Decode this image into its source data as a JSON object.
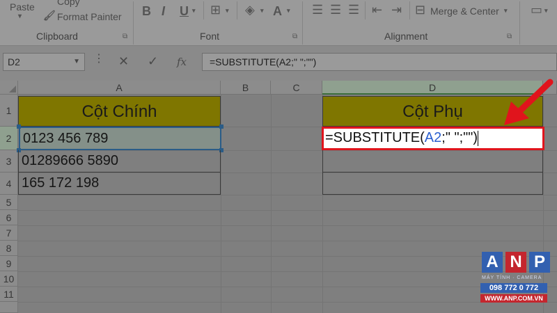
{
  "ribbon": {
    "paste_label": "Paste",
    "copy_label": "Copy",
    "format_painter_label": "Format Painter",
    "clipboard_group": "Clipboard",
    "font_group": "Font",
    "alignment_group": "Alignment",
    "merge_center_label": "Merge & Center",
    "bold_label": "B",
    "italic_label": "I",
    "underline_label": "U",
    "font_color_label": "A"
  },
  "formula_bar": {
    "name_box": "D2",
    "cancel_icon": "✕",
    "enter_icon": "✓",
    "fx_label": "fx",
    "formula": "=SUBSTITUTE(A2;\" \";\"\")"
  },
  "columns": [
    "A",
    "B",
    "C",
    "D"
  ],
  "rows": [
    "1",
    "2",
    "3",
    "4",
    "5",
    "6",
    "7",
    "8",
    "9",
    "10",
    "11"
  ],
  "cells": {
    "A1": "Cột Chính",
    "A2": "0123   456   789",
    "A3": "01289666   5890",
    "A4": "165 172 198",
    "D1": "Cột Phụ",
    "D2_prefix": "=SUBSTITUTE(",
    "D2_ref": "A2",
    "D2_suffix": ";\" \";\"\")"
  },
  "watermark": {
    "letters": [
      "A",
      "N",
      "P"
    ],
    "subtitle": "MÁY TÍNH · CAMERA",
    "phone": "098 772 0 772",
    "website": "WWW.ANP.COM.VN"
  },
  "colors": {
    "header_fill": "#7f7600",
    "edit_border": "#e0141c",
    "active_border": "#2a5c87",
    "arrow": "#e0141c"
  }
}
